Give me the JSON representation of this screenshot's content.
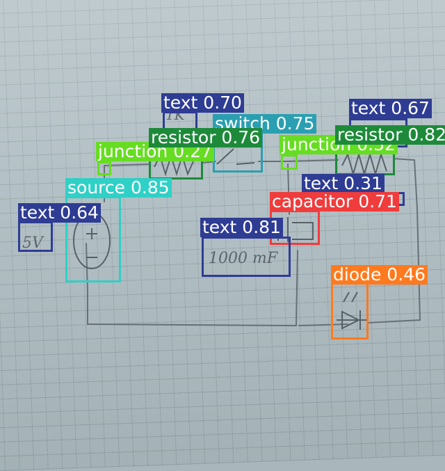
{
  "detections": [
    {
      "label": "text 0.70",
      "color": "#2e3c93",
      "outline": "#2e3c93"
    },
    {
      "label": "text 0.67",
      "color": "#2e3c93",
      "outline": "#2e3c93"
    },
    {
      "label": "switch 0.75",
      "color": "#2a9fb1",
      "outline": "#2a9fb1"
    },
    {
      "label": "resistor 0.76",
      "color": "#1d8a3a",
      "outline": "#1d8a3a"
    },
    {
      "label": "resistor 0.82",
      "color": "#1d8a3a",
      "outline": "#1d8a3a"
    },
    {
      "label": "junction 0.27",
      "color": "#66dd22",
      "outline": "#66dd22"
    },
    {
      "label": "junction 0.32",
      "color": "#66dd22",
      "outline": "#66dd22"
    },
    {
      "label": "source 0.85",
      "color": "#2fd0c6",
      "outline": "#2fd0c6"
    },
    {
      "label": "text 0.31",
      "color": "#2e3c93",
      "outline": "#2e3c93"
    },
    {
      "label": "capacitor 0.71",
      "color": "#f03c3c",
      "outline": "#f03c3c"
    },
    {
      "label": "text 0.64",
      "color": "#2e3c93",
      "outline": "#2e3c93"
    },
    {
      "label": "text 0.81",
      "color": "#2e3c93",
      "outline": "#2e3c93"
    },
    {
      "label": "diode 0.46",
      "color": "#ff7a1e",
      "outline": "#ff7a1e"
    }
  ],
  "handwriting": {
    "voltage": "5V",
    "resistor_a": "1K",
    "capacitance": "1000 mF"
  }
}
